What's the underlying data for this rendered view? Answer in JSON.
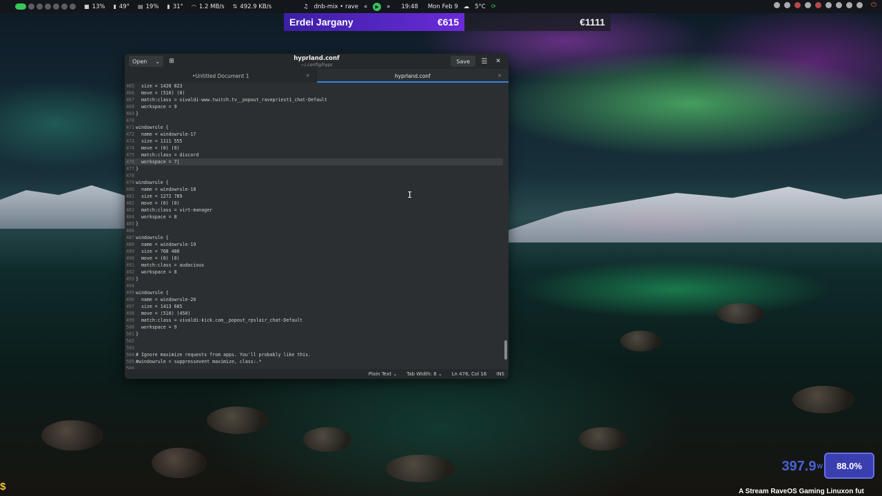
{
  "topbar": {
    "stats": [
      {
        "icon": "cpu-icon",
        "glyph": "■",
        "value": "13%"
      },
      {
        "icon": "temperature-icon",
        "glyph": "▮",
        "value": "49°"
      },
      {
        "icon": "memory-icon",
        "glyph": "▤",
        "value": "19%"
      },
      {
        "icon": "gpu-temp-icon",
        "glyph": "▮",
        "value": "31°"
      },
      {
        "icon": "wifi-icon",
        "glyph": "◠",
        "value": "1.2 MB/s"
      },
      {
        "icon": "download-icon",
        "glyph": "⇅",
        "value": "492.9 KB/s"
      }
    ],
    "media": {
      "prev": "«",
      "track": "dnb-mix • rave",
      "next": "»"
    },
    "time": "19:48",
    "date": "Mon Feb 9",
    "weather": "5°C"
  },
  "banner": {
    "name": "Erdei Jargany",
    "amount_left": "€615",
    "amount_right": "€1111"
  },
  "editor": {
    "open_label": "Open",
    "open_arrow": "⌄",
    "new_icon": "⊞",
    "title": "hyprland.conf",
    "subtitle": "~/.config/hypr",
    "save_label": "Save",
    "menu_icon": "☰",
    "close_icon": "✕",
    "tabs": [
      {
        "label": "•Untitled Document 1",
        "close": "✕"
      },
      {
        "label": "hyprland.conf",
        "close": "✕"
      }
    ],
    "lines": [
      {
        "n": "465",
        "t": "  size = 1420 823"
      },
      {
        "n": "466",
        "t": "  move = (510) (0)"
      },
      {
        "n": "467",
        "t": "  match:class = vivaldi-www.twitch.tv__popout_ravepriest1_chat-Default"
      },
      {
        "n": "468",
        "t": "  workspace = 9"
      },
      {
        "n": "469",
        "t": "}"
      },
      {
        "n": "470",
        "t": ""
      },
      {
        "n": "471",
        "t": "windowrule {"
      },
      {
        "n": "472",
        "t": "  name = windowrule-17"
      },
      {
        "n": "473",
        "t": "  size = 1111 555"
      },
      {
        "n": "474",
        "t": "  move = (0) (0)"
      },
      {
        "n": "475",
        "t": "  match:class = discord"
      },
      {
        "n": "476",
        "t": "  workspace = 7|"
      },
      {
        "n": "477",
        "t": "}"
      },
      {
        "n": "478",
        "t": ""
      },
      {
        "n": "479",
        "t": "windowrule {"
      },
      {
        "n": "480",
        "t": "  name = windowrule-18"
      },
      {
        "n": "481",
        "t": "  size = 1272 789"
      },
      {
        "n": "482",
        "t": "  move = (0) (0)"
      },
      {
        "n": "483",
        "t": "  match:class = virt-manager"
      },
      {
        "n": "484",
        "t": "  workspace = 8"
      },
      {
        "n": "485",
        "t": "}"
      },
      {
        "n": "486",
        "t": ""
      },
      {
        "n": "487",
        "t": "windowrule {"
      },
      {
        "n": "488",
        "t": "  name = windowrule-19"
      },
      {
        "n": "489",
        "t": "  size = 768 480"
      },
      {
        "n": "490",
        "t": "  move = (0) (0)"
      },
      {
        "n": "491",
        "t": "  match:class = audacious"
      },
      {
        "n": "492",
        "t": "  workspace = 8"
      },
      {
        "n": "493",
        "t": "}"
      },
      {
        "n": "494",
        "t": ""
      },
      {
        "n": "495",
        "t": "windowrule {"
      },
      {
        "n": "496",
        "t": "  name = windowrule-20"
      },
      {
        "n": "497",
        "t": "  size = 1413 685"
      },
      {
        "n": "498",
        "t": "  move = (510) (450)"
      },
      {
        "n": "499",
        "t": "  match:class = vivaldi-kick.com__popout_rpslair_chat-Default"
      },
      {
        "n": "500",
        "t": "  workspace = 9"
      },
      {
        "n": "501",
        "t": "}"
      },
      {
        "n": "502",
        "t": ""
      },
      {
        "n": "503",
        "t": ""
      },
      {
        "n": "504",
        "t": "# Ignore maximize requests from apps. You'll probably like this."
      },
      {
        "n": "505",
        "t": "#windowrule = suppressevent maximize, class:.*"
      },
      {
        "n": "506",
        "t": ""
      }
    ],
    "current_line": "476",
    "status": {
      "language": "Plain Text ⌄",
      "tab_width": "Tab Width: 8 ⌄",
      "position": "Ln 476, Col 16",
      "mode": "INS"
    }
  },
  "overlay": {
    "power_value": "397.9",
    "power_unit": "W",
    "usage": "88.0%",
    "ticker": "A Stream RaveOS Gaming Linuxon fut",
    "dollar": "$"
  },
  "colors": {
    "accent": "#3584e4",
    "workspace_active": "#38c75a",
    "banner": "#5a28c8",
    "usage_box": "#3a3fb0"
  }
}
